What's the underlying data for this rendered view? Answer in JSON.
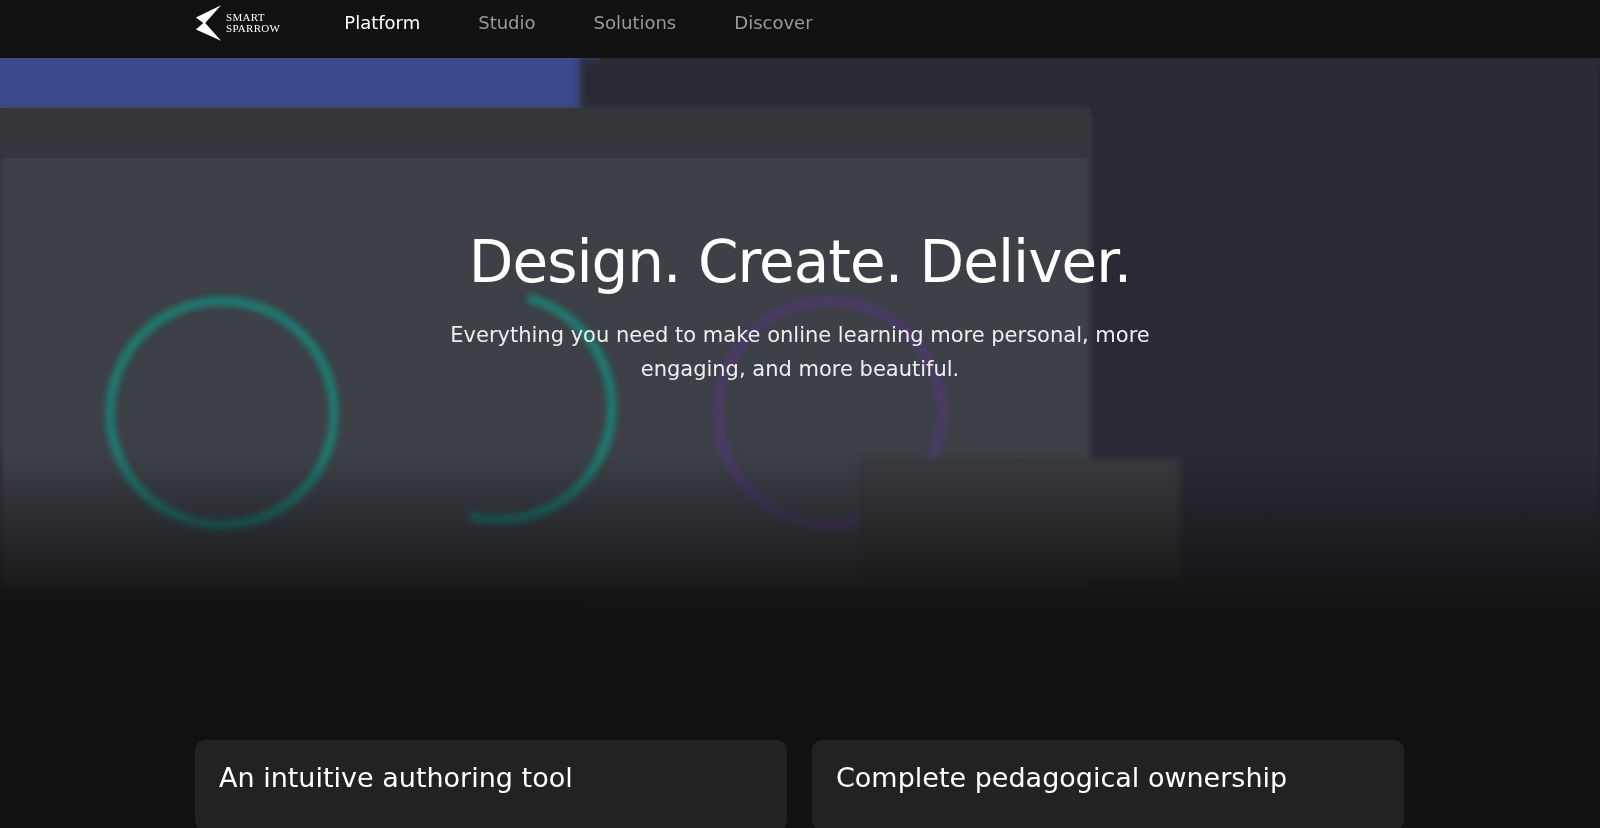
{
  "logo": {
    "line_1": "SMART",
    "line_2": "SPARROW"
  },
  "nav": [
    {
      "label": "Platform",
      "selected": true
    },
    {
      "label": "Studio",
      "selected": false
    },
    {
      "label": "Solutions",
      "selected": false
    },
    {
      "label": "Discover",
      "selected": false
    }
  ],
  "hero": {
    "title": "Design. Create. Deliver.",
    "subtitle": "Everything you need to make online learning more personal, more engaging, and more beautiful."
  },
  "cards": [
    {
      "title": "An intuitive authoring tool"
    },
    {
      "title": "Complete pedagogical ownership"
    }
  ]
}
